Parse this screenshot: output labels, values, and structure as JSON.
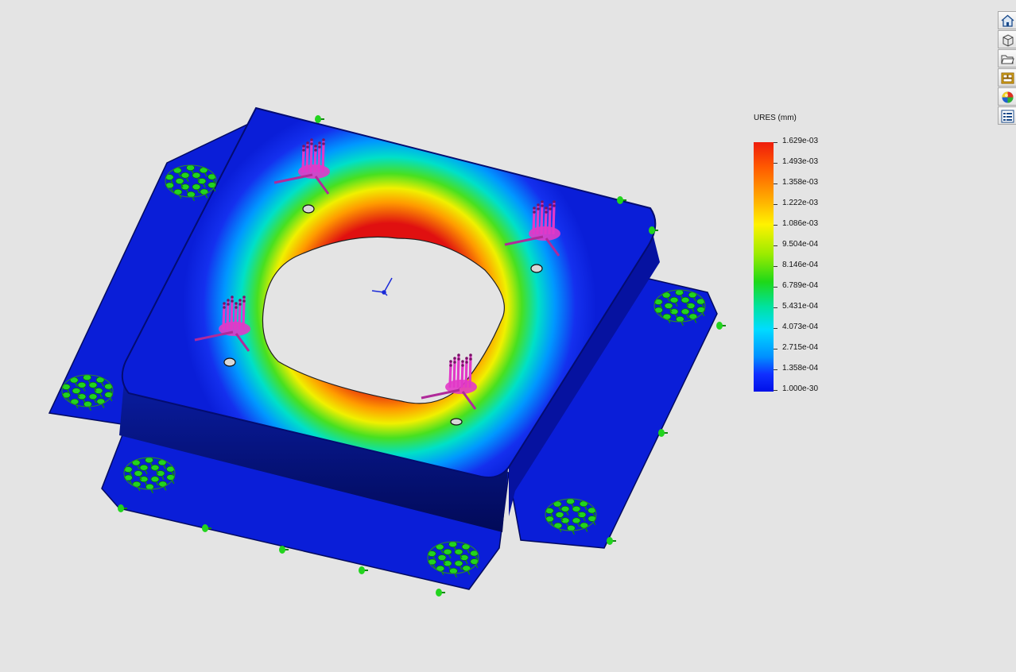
{
  "app": {
    "toolbar": {
      "items": [
        {
          "icon": "home-icon"
        },
        {
          "icon": "3d-model-icon"
        },
        {
          "icon": "folder-icon"
        },
        {
          "icon": "view-palette-icon"
        },
        {
          "icon": "appearance-icon"
        },
        {
          "icon": "properties-list-icon"
        }
      ]
    }
  },
  "legend": {
    "title": "URES (mm)",
    "values": [
      "1.629e-03",
      "1.493e-03",
      "1.358e-03",
      "1.222e-03",
      "1.086e-03",
      "9.504e-04",
      "8.146e-04",
      "6.789e-04",
      "5.431e-04",
      "4.073e-04",
      "2.715e-04",
      "1.358e-04",
      "1.000e-30"
    ],
    "colors": {
      "max": "#ee1c0c",
      "mid": "#1ed818",
      "min": "#0010e8"
    }
  },
  "model": {
    "fixtures_color": "#22d41e",
    "loads_color": "#e239c8",
    "base_color": "#0a1ed8"
  }
}
